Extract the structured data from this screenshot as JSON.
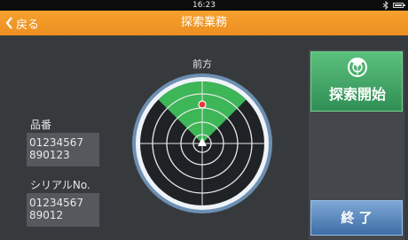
{
  "status_bar": {
    "time": "16:23"
  },
  "header": {
    "back_label": "戻る",
    "title": "探索業務"
  },
  "radar": {
    "direction_label": "前方"
  },
  "product": {
    "label": "品番",
    "value_line1": "01234567",
    "value_line2": "890123"
  },
  "serial": {
    "label": "シリアルNo.",
    "value_line1": "01234567",
    "value_line2": "89012"
  },
  "buttons": {
    "start_label": "探索開始",
    "end_label": "終 了"
  },
  "colors": {
    "title_bar": "#f0961f",
    "radar_sector": "#3fbf5a",
    "target_dot": "#e53935",
    "start_button": "#3fa866",
    "end_button": "#5a88c0"
  },
  "icons": {
    "back": "chevron-left-icon",
    "bluetooth": "bluetooth-icon",
    "battery": "battery-icon",
    "start": "radar-search-icon"
  }
}
